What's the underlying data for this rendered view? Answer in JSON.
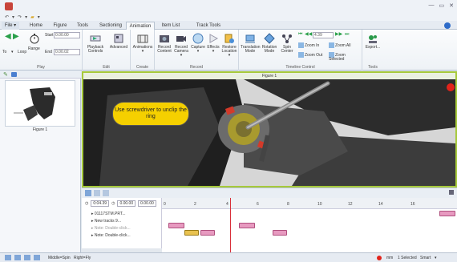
{
  "menu": {
    "file": "File ▾",
    "tabs": [
      "Home",
      "Figure",
      "Tools",
      "Sectioning",
      "Animation",
      "Item List",
      "Track Tools"
    ],
    "active_tab": "Animation"
  },
  "ribbon": {
    "play": {
      "label": "Play",
      "loop": "Loop",
      "to": "To",
      "range": "Range",
      "start": "Start",
      "start_value": "0.00.00",
      "end": "End",
      "end_value": "0.00.02"
    },
    "edit": {
      "label": "Edit",
      "playback_controls": "Playback Controls",
      "advanced": "Advanced"
    },
    "create": {
      "label": "Create",
      "animations": "Animations"
    },
    "record": {
      "label": "Record",
      "record_content": "Record Content",
      "record_camera": "Record Camera",
      "capture": "Capture",
      "effects": "Effects",
      "restore_location": "Restore Location"
    },
    "timeline_control": {
      "label": "Timeline Control",
      "translation_mode": "Translation Mode",
      "rotation_mode": "Rotation Mode",
      "spin_center": "Spin Center",
      "time_value": "4.39",
      "zoom_in": "Zoom In",
      "zoom_all": "Zoom All",
      "zoom_out": "Zoom Out",
      "zoom_selected": "Zoom Selected"
    },
    "tools": {
      "label": "Tools",
      "export": "Export..."
    }
  },
  "thumbnail": {
    "label": "Figure 1"
  },
  "viewport": {
    "title": "Figure 1",
    "callout": "Use screwdriver to unclip the ring"
  },
  "timeline": {
    "current_time": "0:04.39",
    "start_time": "0.00.00",
    "end_time": "0.00.00",
    "tree": [
      "01117STM.PRT...",
      "New tracks 9...",
      "Note: Double-click...",
      "Note: Double-click..."
    ],
    "ruler_ticks": [
      "0",
      "2",
      "4",
      "6",
      "8",
      "10",
      "12",
      "14",
      "16"
    ]
  },
  "status": {
    "middle_spin": "Middle=Spin",
    "right_fly": "Right=Fly",
    "units": "mm",
    "selected": "1 Selected",
    "mode": "Smart"
  },
  "colors": {
    "viewport_border": "#a6c93a",
    "callout_fill": "#f5d000",
    "timeline_bar": "#e79ac0",
    "playhead": "#d9303a"
  }
}
